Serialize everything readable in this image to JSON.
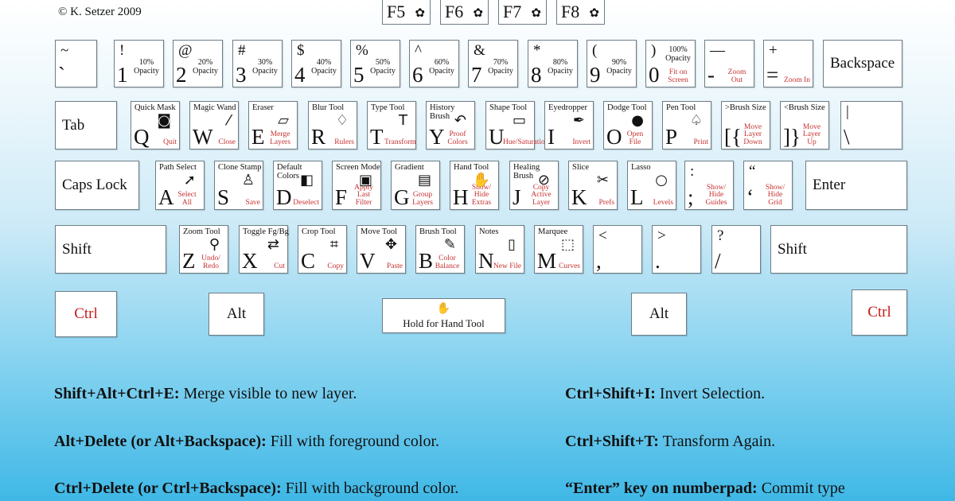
{
  "copyright": "© K. Setzer 2009",
  "fkeys": [
    {
      "label": "F5"
    },
    {
      "label": "F6"
    },
    {
      "label": "F7"
    },
    {
      "label": "F8"
    }
  ],
  "fkey_icon": "palette-icon",
  "rows": [
    [
      {
        "shift": "~",
        "main": "`"
      },
      {
        "shift": "!",
        "main": "1",
        "small": "10% Opacity"
      },
      {
        "shift": "@",
        "main": "2",
        "small": "20% Opacity"
      },
      {
        "shift": "#",
        "main": "3",
        "small": "30% Opacity"
      },
      {
        "shift": "$",
        "main": "4",
        "small": "40% Opacity"
      },
      {
        "shift": "%",
        "main": "5",
        "small": "50% Opacity"
      },
      {
        "shift": "^",
        "main": "6",
        "small": "60% Opacity"
      },
      {
        "shift": "&",
        "main": "7",
        "small": "70% Opacity"
      },
      {
        "shift": "*",
        "main": "8",
        "small": "80% Opacity"
      },
      {
        "shift": "(",
        "main": "9",
        "small": "90% Opacity"
      },
      {
        "shift": ")",
        "main": "0",
        "small": "100% Opacity",
        "action": "Fit on Screen"
      },
      {
        "shift": "—",
        "main": "-",
        "action": "Zoom Out"
      },
      {
        "shift": "+",
        "main": "=",
        "action": "Zoom In"
      },
      {
        "label": "Backspace"
      }
    ],
    [
      {
        "label": "Tab"
      },
      {
        "tool": "Quick Mask",
        "main": "Q",
        "action": "Quit",
        "icon": "quick-mask-icon",
        "glyph": "◙"
      },
      {
        "tool": "Magic Wand",
        "main": "W",
        "action": "Close",
        "icon": "magic-wand-icon",
        "glyph": "⁄"
      },
      {
        "tool": "Eraser",
        "main": "E",
        "action": "Merge Layers",
        "icon": "eraser-icon",
        "glyph": "▱"
      },
      {
        "tool": "Blur Tool",
        "main": "R",
        "action": "Rulers",
        "icon": "blur-drop-icon",
        "glyph": "♢"
      },
      {
        "tool": "Type Tool",
        "main": "T",
        "action": "Transform",
        "icon": "type-icon",
        "glyph": "T"
      },
      {
        "tool": "History Brush",
        "main": "Y",
        "action": "Proof Colors",
        "icon": "history-brush-icon",
        "glyph": "↶"
      },
      {
        "tool": "Shape Tool",
        "main": "U",
        "action": "Hue/Saturation",
        "icon": "shape-icon",
        "glyph": "▭"
      },
      {
        "tool": "Eyedropper",
        "main": "I",
        "action": "Invert",
        "icon": "eyedropper-icon",
        "glyph": "✒"
      },
      {
        "tool": "Dodge Tool",
        "main": "O",
        "action": "Open File",
        "icon": "dodge-icon",
        "glyph": "●"
      },
      {
        "tool": "Pen Tool",
        "main": "P",
        "action": "Print",
        "icon": "pen-icon",
        "glyph": "♤"
      },
      {
        "tool": ">Brush Size",
        "main": "[{",
        "action": "Move Layer Down"
      },
      {
        "tool": "<Brush Size",
        "main": "]}",
        "action": "Move Layer Up"
      },
      {
        "shift": "|",
        "main": "\\"
      }
    ],
    [
      {
        "label": "Caps Lock"
      },
      {
        "tool": "Path Select",
        "main": "A",
        "action": "Select All",
        "icon": "cursor-arrow-icon",
        "glyph": "➚"
      },
      {
        "tool": "Clone Stamp",
        "main": "S",
        "action": "Save",
        "icon": "stamp-icon",
        "glyph": "♙"
      },
      {
        "tool": "Default Colors",
        "main": "D",
        "action": "Deselect",
        "icon": "default-colors-icon",
        "glyph": "◧"
      },
      {
        "tool": "Screen Mode",
        "main": "F",
        "action": "Apply Last Filter",
        "icon": "screen-mode-icon",
        "glyph": "▣"
      },
      {
        "tool": "Gradient",
        "main": "G",
        "action": "Group Layers",
        "icon": "gradient-icon",
        "glyph": "▤"
      },
      {
        "tool": "Hand Tool",
        "main": "H",
        "action": "Show/ Hide Extras",
        "icon": "hand-icon",
        "glyph": "✋"
      },
      {
        "tool": "Healing Brush",
        "main": "J",
        "action": "Copy Active Layer",
        "icon": "bandage-icon",
        "glyph": "⊘"
      },
      {
        "tool": "Slice",
        "main": "K",
        "action": "Prefs",
        "icon": "slice-knife-icon",
        "glyph": "✂"
      },
      {
        "tool": "Lasso",
        "main": "L",
        "action": "Levels",
        "icon": "lasso-icon",
        "glyph": "○"
      },
      {
        "shift": ":",
        "main": ";",
        "action": "Show/ Hide Guides"
      },
      {
        "shift": "“",
        "main": "‘",
        "action": "Show/ Hide Grid"
      },
      {
        "label": "Enter"
      }
    ],
    [
      {
        "label": "Shift"
      },
      {
        "tool": "Zoom Tool",
        "main": "Z",
        "action": "Undo/ Redo",
        "icon": "magnifier-icon",
        "glyph": "⚲"
      },
      {
        "tool": "Toggle Fg/Bg",
        "main": "X",
        "action": "Cut",
        "icon": "swap-colors-icon",
        "glyph": "⇄"
      },
      {
        "tool": "Crop Tool",
        "main": "C",
        "action": "Copy",
        "icon": "crop-icon",
        "glyph": "⌗"
      },
      {
        "tool": "Move Tool",
        "main": "V",
        "action": "Paste",
        "icon": "move-icon",
        "glyph": "✥"
      },
      {
        "tool": "Brush Tool",
        "main": "B",
        "action": "Color Balance",
        "icon": "brush-icon",
        "glyph": "✎"
      },
      {
        "tool": "Notes",
        "main": "N",
        "action": "New File",
        "icon": "note-page-icon",
        "glyph": "▯"
      },
      {
        "tool": "Marquee",
        "main": "M",
        "action": "Curves",
        "icon": "marquee-icon",
        "glyph": "⬚"
      },
      {
        "shift": "<",
        "main": ","
      },
      {
        "shift": ">",
        "main": "."
      },
      {
        "shift": "?",
        "main": "/"
      },
      {
        "label": "Shift"
      }
    ]
  ],
  "bottom_row": {
    "ctrl_left": "Ctrl",
    "alt_left": "Alt",
    "space": "Hold for Hand Tool",
    "alt_right": "Alt",
    "ctrl_right": "Ctrl"
  },
  "ctrl_color": "#c41a1a",
  "notes": [
    {
      "keys": "Shift+Alt+Ctrl+E:",
      "text": " Merge visible to new layer."
    },
    {
      "keys": "Alt+Delete (or Alt+Backspace):",
      "text": " Fill with foreground color."
    },
    {
      "keys": "Ctrl+Delete (or Ctrl+Backspace):",
      "text": " Fill with background color."
    },
    {
      "keys": "Ctrl+Shift+I:",
      "text": " Invert Selection."
    },
    {
      "keys": "Ctrl+Shift+T:",
      "text": " Transform Again."
    },
    {
      "keys": "“Enter” key on numberpad:",
      "text": " Commit type"
    }
  ]
}
